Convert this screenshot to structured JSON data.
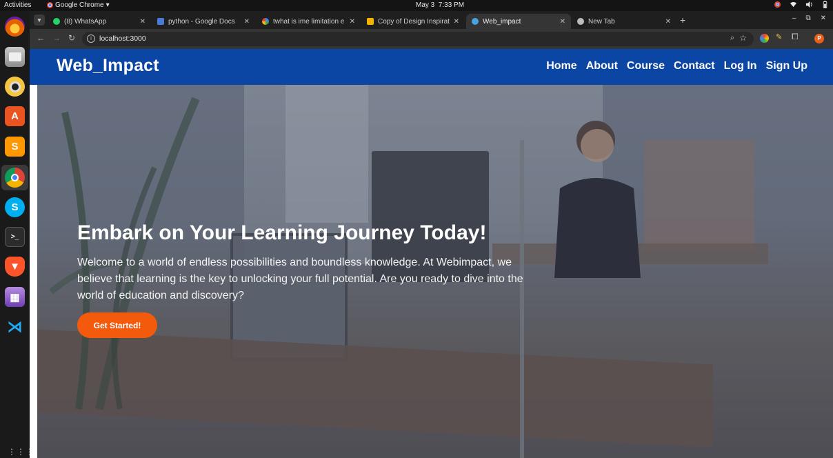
{
  "system_bar": {
    "activities": "Activities",
    "app_name": "Google Chrome",
    "app_menu_arrow": "▾",
    "date": "May 3",
    "time": "7:33 PM"
  },
  "dock": {
    "items": [
      {
        "name": "firefox-icon",
        "color": "#e66000"
      },
      {
        "name": "files-icon",
        "color": "#9b9b9b"
      },
      {
        "name": "rhythmbox-icon",
        "color": "#f5c542"
      },
      {
        "name": "app-center-icon",
        "color": "#e95420"
      },
      {
        "name": "sublime-text-icon",
        "color": "#ff9800"
      },
      {
        "name": "chrome-icon",
        "color": "#34a853"
      },
      {
        "name": "skype-icon",
        "color": "#00aff0"
      },
      {
        "name": "terminal-icon",
        "color": "#2c2c2c"
      },
      {
        "name": "brave-icon",
        "color": "#fb542b"
      },
      {
        "name": "video-editor-icon",
        "color": "#8a5cc7"
      },
      {
        "name": "vscode-icon",
        "color": "#0a7acc"
      }
    ]
  },
  "browser": {
    "tabs": [
      {
        "title": "(8) WhatsApp",
        "favicon": "whatsapp-icon",
        "favicon_color": "#25d366"
      },
      {
        "title": "python - Google Docs",
        "favicon": "docs-icon",
        "favicon_color": "#4a7bd8"
      },
      {
        "title": "twhat is ime limitation e",
        "favicon": "google-icon",
        "favicon_color": "#ffffff"
      },
      {
        "title": "Copy of Design Inspiratio",
        "favicon": "slides-icon",
        "favicon_color": "#f4b400"
      },
      {
        "title": "Web_impact",
        "favicon": "globe-icon",
        "favicon_color": "#4aa3df",
        "active": true
      },
      {
        "title": "New Tab",
        "favicon": "chrome-icon",
        "favicon_color": "#bdbdbd"
      }
    ],
    "url": "localhost:3000"
  },
  "site": {
    "brand": "Web_Impact",
    "nav": [
      "Home",
      "About",
      "Course",
      "Contact",
      "Log In",
      "Sign Up"
    ],
    "hero_title": "Embark on Your Learning Journey Today!",
    "hero_text": "Welcome to a world of endless possibilities and boundless knowledge. At Webimpact, we believe that learning is the key to unlocking your full potential. Are you ready to dive into the world of education and discovery?",
    "cta_label": "Get Started!",
    "colors": {
      "nav_bg": "#0b46a5",
      "cta": "#f45a0c"
    }
  }
}
